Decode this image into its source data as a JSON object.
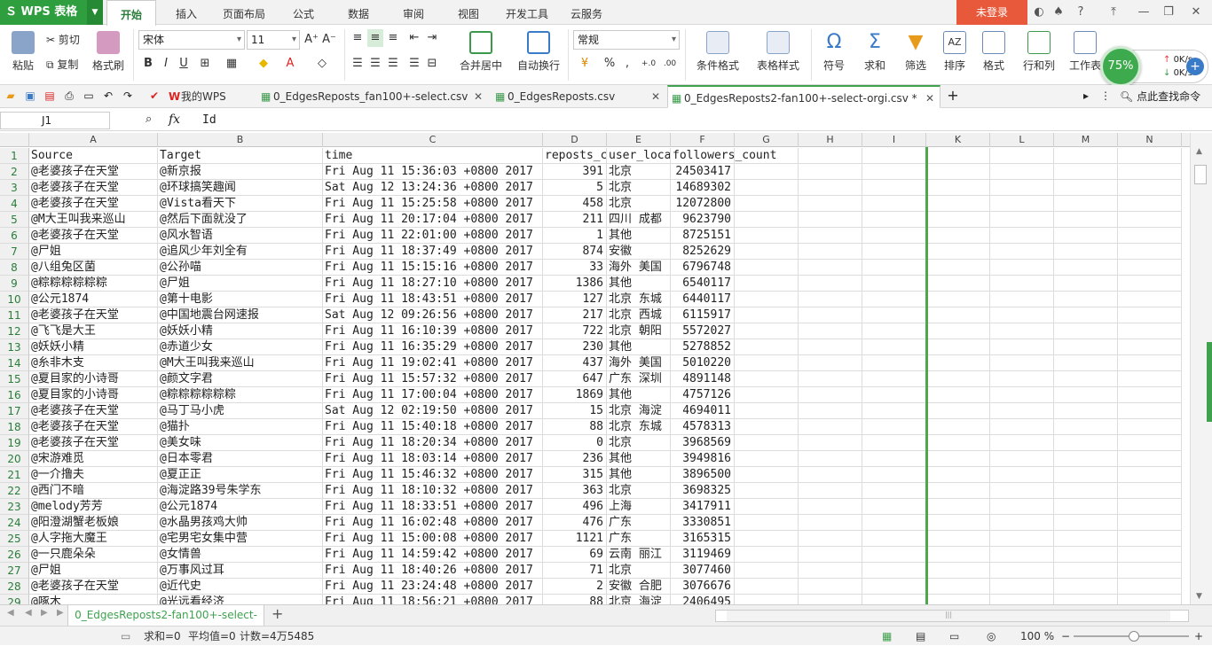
{
  "app": {
    "title": "WPS 表格",
    "login": "未登录"
  },
  "menu_tabs": [
    "开始",
    "插入",
    "页面布局",
    "公式",
    "数据",
    "审阅",
    "视图",
    "开发工具",
    "云服务"
  ],
  "ribbon": {
    "paste": "粘贴",
    "cut": "剪切",
    "copy": "复制",
    "format_painter": "格式刷",
    "font_name": "宋体",
    "font_size": "11",
    "merge_center": "合并居中",
    "wrap_text": "自动换行",
    "number_format": "常规",
    "conditional_format": "条件格式",
    "table_style": "表格样式",
    "symbol": "符号",
    "sum": "求和",
    "filter": "筛选",
    "sort": "排序",
    "format": "格式",
    "row_col": "行和列",
    "worksheet": "工作表"
  },
  "net_widget": {
    "percent": "75%",
    "up": "0K/s",
    "down": "0K/s"
  },
  "doc_tabs": [
    {
      "label": "我的WPS",
      "active": false
    },
    {
      "label": "0_EdgesReposts_fan100+-select.csv",
      "active": false
    },
    {
      "label": "0_EdgesReposts.csv",
      "active": false
    },
    {
      "label": "0_EdgesReposts2-fan100+-select-orgi.csv *",
      "active": true
    }
  ],
  "search_cmd": "点此查找命令",
  "formula_bar": {
    "name_box": "J1",
    "fx": "fx",
    "content": "Id"
  },
  "columns": [
    "A",
    "B",
    "C",
    "D",
    "E",
    "F",
    "G",
    "H",
    "I",
    "K",
    "L",
    "M",
    "N"
  ],
  "rows": [
    [
      "Source",
      "Target",
      "time",
      "reposts_c",
      "user_loca",
      "followers_count"
    ],
    [
      "@老婆孩子在天堂",
      "@新京报",
      "Fri Aug 11 15:36:03 +0800 2017",
      "391",
      "北京",
      "24503417"
    ],
    [
      "@老婆孩子在天堂",
      "@环球搞笑趣闻",
      "Sat Aug 12 13:24:36 +0800 2017",
      "5",
      "北京",
      "14689302"
    ],
    [
      "@老婆孩子在天堂",
      "@Vista看天下",
      "Fri Aug 11 15:25:58 +0800 2017",
      "458",
      "北京",
      "12072800"
    ],
    [
      "@M大王叫我来巡山",
      "@然后下面就没了",
      "Fri Aug 11 20:17:04 +0800 2017",
      "211",
      "四川 成都",
      "9623790"
    ],
    [
      "@老婆孩子在天堂",
      "@风水智语",
      "Fri Aug 11 22:01:00 +0800 2017",
      "1",
      "其他",
      "8725151"
    ],
    [
      "@尸姐",
      "@追风少年刘全有",
      "Fri Aug 11 18:37:49 +0800 2017",
      "874",
      "安徽",
      "8252629"
    ],
    [
      "@八组兔区菌",
      "@公孙喵",
      "Fri Aug 11 15:15:16 +0800 2017",
      "33",
      "海外 美国",
      "6796748"
    ],
    [
      "@粽粽粽粽粽粽",
      "@尸姐",
      "Fri Aug 11 18:27:10 +0800 2017",
      "1386",
      "其他",
      "6540117"
    ],
    [
      "@公元1874",
      "@第十电影",
      "Fri Aug 11 18:43:51 +0800 2017",
      "127",
      "北京 东城",
      "6440117"
    ],
    [
      "@老婆孩子在天堂",
      "@中国地震台网速报",
      "Sat Aug 12 09:26:56 +0800 2017",
      "217",
      "北京 西城",
      "6115917"
    ],
    [
      "@飞飞是大王",
      "@妖妖小精",
      "Fri Aug 11 16:10:39 +0800 2017",
      "722",
      "北京 朝阳",
      "5572027"
    ],
    [
      "@妖妖小精",
      "@赤道少女",
      "Fri Aug 11 16:35:29 +0800 2017",
      "230",
      "其他",
      "5278852"
    ],
    [
      "@糸非木支",
      "@M大王叫我来巡山",
      "Fri Aug 11 19:02:41 +0800 2017",
      "437",
      "海外 美国",
      "5010220"
    ],
    [
      "@夏目家的小诗哥",
      "@颜文字君",
      "Fri Aug 11 15:57:32 +0800 2017",
      "647",
      "广东 深圳",
      "4891148"
    ],
    [
      "@夏目家的小诗哥",
      "@粽粽粽粽粽粽",
      "Fri Aug 11 17:00:04 +0800 2017",
      "1869",
      "其他",
      "4757126"
    ],
    [
      "@老婆孩子在天堂",
      "@马丁马小虎",
      "Sat Aug 12 02:19:50 +0800 2017",
      "15",
      "北京 海淀",
      "4694011"
    ],
    [
      "@老婆孩子在天堂",
      "@猫扑",
      "Fri Aug 11 15:40:18 +0800 2017",
      "88",
      "北京 东城",
      "4578313"
    ],
    [
      "@老婆孩子在天堂",
      "@美女味",
      "Fri Aug 11 18:20:34 +0800 2017",
      "0",
      "北京",
      "3968569"
    ],
    [
      "@宋游难觅",
      "@日本零君",
      "Fri Aug 11 18:03:14 +0800 2017",
      "236",
      "其他",
      "3949816"
    ],
    [
      "@一介撸夫",
      "@夏正正",
      "Fri Aug 11 15:46:32 +0800 2017",
      "315",
      "其他",
      "3896500"
    ],
    [
      "@西门不暗",
      "@海淀路39号朱学东",
      "Fri Aug 11 18:10:32 +0800 2017",
      "363",
      "北京",
      "3698325"
    ],
    [
      "@melody芳芳",
      "@公元1874",
      "Fri Aug 11 18:33:51 +0800 2017",
      "496",
      "上海",
      "3417911"
    ],
    [
      "@阳澄湖蟹老板娘",
      "@水晶男孩鸡大帅",
      "Fri Aug 11 16:02:48 +0800 2017",
      "476",
      "广东",
      "3330851"
    ],
    [
      "@人字拖大魔王",
      "@宅男宅女集中营",
      "Fri Aug 11 15:00:08 +0800 2017",
      "1121",
      "广东",
      "3165315"
    ],
    [
      "@一只鹿朵朵",
      "@女情兽",
      "Fri Aug 11 14:59:42 +0800 2017",
      "69",
      "云南 丽江",
      "3119469"
    ],
    [
      "@尸姐",
      "@万事风过耳",
      "Fri Aug 11 18:40:26 +0800 2017",
      "71",
      "北京",
      "3077460"
    ],
    [
      "@老婆孩子在天堂",
      "@近代史",
      "Fri Aug 11 23:24:48 +0800 2017",
      "2",
      "安徽 合肥",
      "3076676"
    ],
    [
      "@啄木",
      "@光远看经济",
      "Fri Aug 11 18:56:21 +0800 2017",
      "88",
      "北京 海淀",
      "2406495"
    ]
  ],
  "sheet_tab": "0_EdgesReposts2-fan100+-select-",
  "status": {
    "sum": "求和=0",
    "avg": "平均值=0",
    "count": "计数=4万5485",
    "zoom": "100 %"
  },
  "colors": {
    "accent": "#3fa14e",
    "wps_green": "#2f9e3f",
    "login_bg": "#e8593b"
  }
}
